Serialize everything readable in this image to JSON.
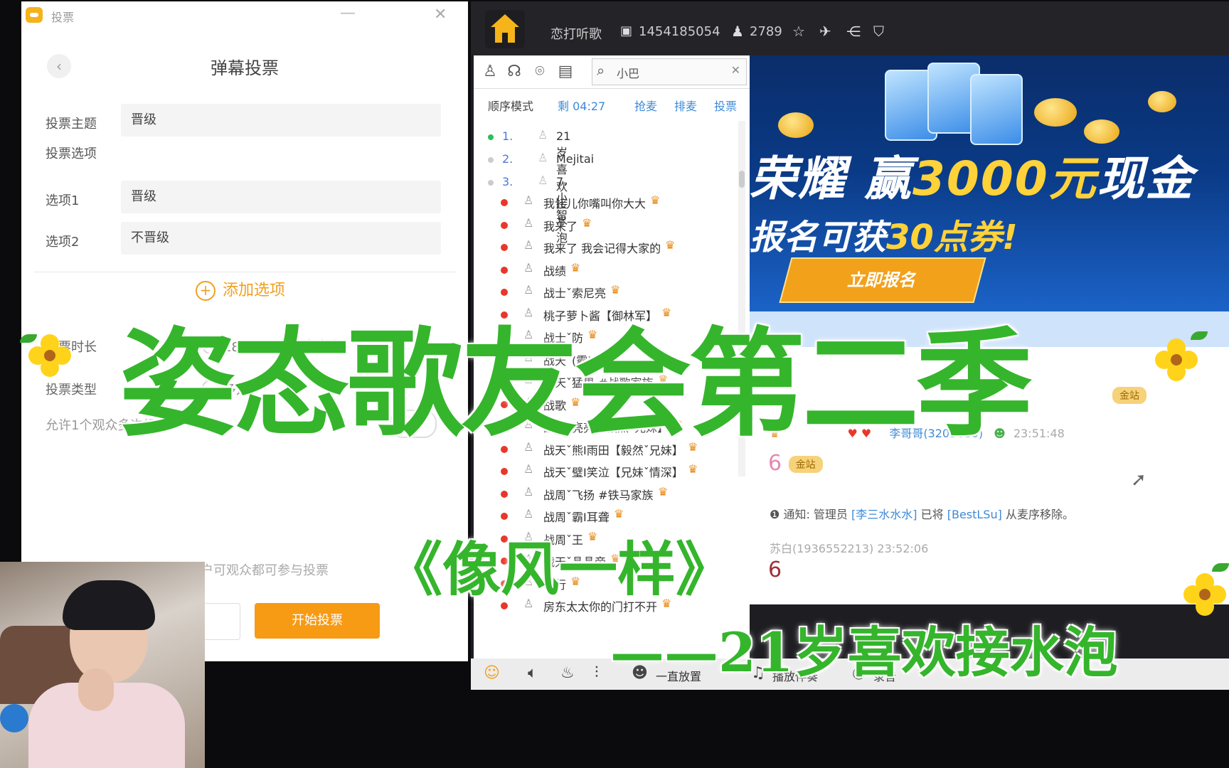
{
  "vote": {
    "window_title": "投票",
    "dialog_title": "弹幕投票",
    "back_icon": "chevron-left-icon",
    "topic_label": "投票主题",
    "topic_value": "晋级",
    "options_label": "投票选项",
    "option1_label": "选项1",
    "option1_value": "晋级",
    "option2_label": "选项2",
    "option2_value": "不晋级",
    "add_option_label": "添加选项",
    "duration_label": "投票时长",
    "duration_180": "180秒",
    "duration_custom": "自定义",
    "type_label": "投票类型",
    "type_multi": "多选",
    "allow_text": "允许1个观众多次投票",
    "hint_text": "仅关注用户可观众都可参与投票",
    "start_button": "开始投票"
  },
  "client": {
    "room_name": "恋打听歌",
    "room_id": "1454185054",
    "viewers": "2789",
    "search_value": "小巴",
    "sort_mode": "顺序模式",
    "timer": "剩 04:27",
    "sort_links": [
      "抢麦",
      "排麦",
      "投票"
    ],
    "queue": [
      {
        "num": "1.",
        "name": "21岁喜欢接水泡",
        "dot": "#2bbf5a"
      },
      {
        "num": "2.",
        "name": "Mejitai",
        "dot": "#cccccc"
      },
      {
        "num": "3.",
        "name": "7.小智",
        "dot": "#cccccc"
      }
    ],
    "users": [
      "我让儿你嘴叫你大大",
      "我来了",
      "我来了 我会记得大家的",
      "战绩",
      "战士ˇ索尼亮",
      "桃子萝卜酱【御林军】",
      "战士ˇ防",
      "战天ˇ(霸)",
      "战天ˇ猛男 #战歌家族",
      "战歌",
      "战天ˇ亮亮【毅然ˇ兄妹】",
      "战天ˇ熊Ⅰ雨田【毅然ˇ兄妹】",
      "战天ˇ璧Ⅰ笑泣【兄妹ˇ情深】",
      "战周ˇ飞扬 #铁马家族",
      "战周ˇ霸Ⅰ耳聋",
      "战周ˇ王",
      "战天ˇ晶晶帝",
      "良行",
      "房东太太你的门打不开"
    ],
    "banner_line1_white": "荣耀 赢",
    "banner_line1_gold": "3000元",
    "banner_line1_tail": "现金",
    "banner_line2_white": "报名可获",
    "banner_line2_gold": "30点券!",
    "banner_cta": "立即报名",
    "chat": {
      "badge1": "金站",
      "msg_user": "李哥哥(3203680)",
      "msg_time": "23:51:48",
      "six1": "6",
      "badge2": "金站",
      "notice_prefix": "通知: 管理员",
      "notice_admin": "[李三水水水]",
      "notice_mid": "已将",
      "notice_target": "[BestLSu]",
      "notice_suffix": "从麦序移除。",
      "user2": "苏白(1936552213)",
      "user2_time": "23:52:06",
      "six2": "6"
    },
    "bottom_labels": [
      "一直放置",
      "播放伴奏",
      "录音"
    ]
  },
  "overlay": {
    "main_title": "姿态歌友会第二季",
    "song_title": "《像风一样》",
    "artist": "——21岁喜欢接水泡"
  },
  "colors": {
    "overlay_green": "#35b52c",
    "start_button": "#f79a14",
    "accent_orange": "#f0a020",
    "link_blue": "#3d8ad8",
    "online_red": "#e8372a"
  }
}
